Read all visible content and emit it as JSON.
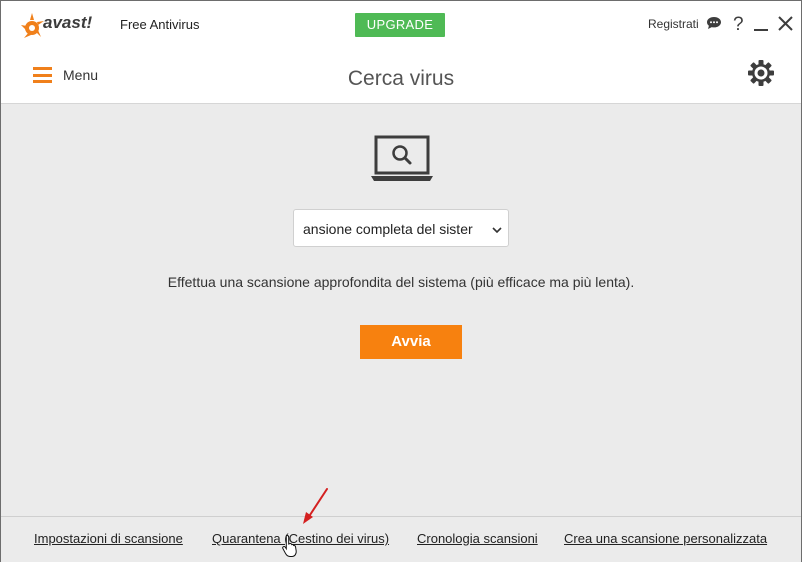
{
  "app": {
    "brand": "avast!",
    "product": "Free Antivirus",
    "upgrade_label": "UPGRADE",
    "register_label": "Registrati",
    "help_label": "?"
  },
  "header": {
    "menu_label": "Menu",
    "title": "Cerca virus"
  },
  "scan": {
    "selected": "ansione completa del sister",
    "description": "Effettua una scansione approfondita del sistema (più efficace ma più lenta).",
    "start_label": "Avvia"
  },
  "footer": {
    "links": [
      "Impostazioni di scansione",
      "Quarantena (Cestino dei virus)",
      "Cronologia scansioni",
      "Crea una scansione personalizzata"
    ]
  },
  "colors": {
    "accent": "#f7810f",
    "upgrade": "#4fba55",
    "annotation_arrow": "#d42020"
  },
  "icons": [
    "avast-logo",
    "chat-icon",
    "help-icon",
    "minimize-icon",
    "close-icon",
    "hamburger-icon",
    "gear-icon",
    "laptop-search-icon",
    "chevron-down-icon",
    "red-arrow",
    "hand-cursor"
  ]
}
